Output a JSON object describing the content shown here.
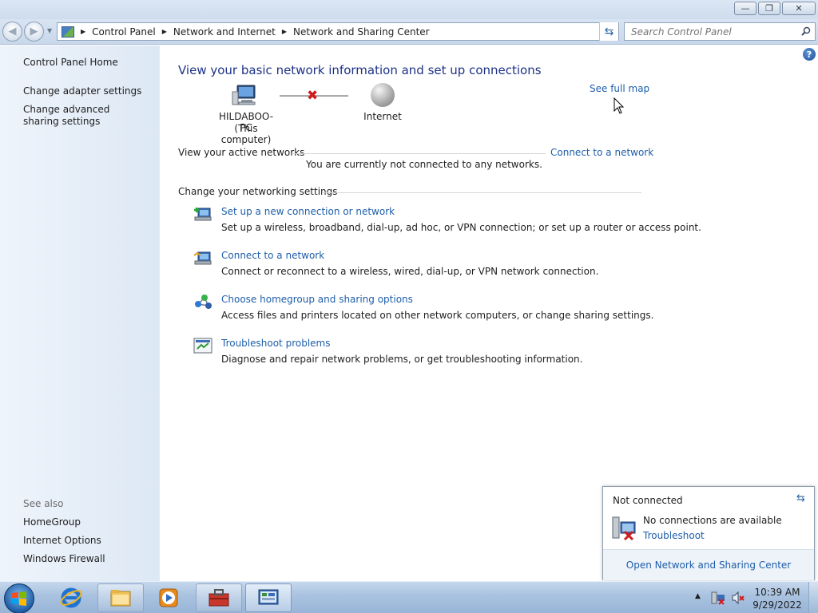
{
  "address": {
    "breadcrumbs": [
      "Control Panel",
      "Network and Internet",
      "Network and Sharing Center"
    ]
  },
  "search": {
    "placeholder": "Search Control Panel"
  },
  "sidebar": {
    "items": [
      {
        "label": "Control Panel Home"
      },
      {
        "label": "Change adapter settings"
      },
      {
        "label": "Change advanced sharing settings"
      }
    ],
    "see_also_label": "See also",
    "see_also": [
      {
        "label": "HomeGroup"
      },
      {
        "label": "Internet Options"
      },
      {
        "label": "Windows Firewall"
      }
    ]
  },
  "main": {
    "heading": "View your basic network information and set up connections",
    "see_full_map": "See full map",
    "map": {
      "computer_name": "HILDABOO-PC",
      "computer_sub": "(This computer)",
      "internet_label": "Internet"
    },
    "active_networks": {
      "label": "View your active networks",
      "connect_link": "Connect to a network",
      "status": "You are currently not connected to any networks."
    },
    "settings": {
      "label": "Change your networking settings",
      "tasks": [
        {
          "title": "Set up a new connection or network",
          "desc": "Set up a wireless, broadband, dial-up, ad hoc, or VPN connection; or set up a router or access point.",
          "icon": "new-connection-icon"
        },
        {
          "title": "Connect to a network",
          "desc": "Connect or reconnect to a wireless, wired, dial-up, or VPN network connection.",
          "icon": "connect-network-icon"
        },
        {
          "title": "Choose homegroup and sharing options",
          "desc": "Access files and printers located on other network computers, or change sharing settings.",
          "icon": "homegroup-icon"
        },
        {
          "title": "Troubleshoot problems",
          "desc": "Diagnose and repair network problems, or get troubleshooting information.",
          "icon": "troubleshoot-icon"
        }
      ]
    }
  },
  "flyout": {
    "status": "Not connected",
    "message": "No connections are available",
    "troubleshoot": "Troubleshoot",
    "open_center": "Open Network and Sharing Center"
  },
  "taskbar": {
    "time": "10:39 AM",
    "date": "9/29/2022",
    "pinned": [
      "start-orb",
      "internet-explorer-icon",
      "windows-explorer-icon",
      "media-player-icon",
      "toolbox-icon",
      "control-panel-icon"
    ]
  },
  "colors": {
    "link": "#1e5ea9",
    "heading": "#1e3287",
    "error_red": "#d01c1c",
    "sidebar_bg": "#dde8f5",
    "taskbar_bg": "#a9c2e0"
  }
}
